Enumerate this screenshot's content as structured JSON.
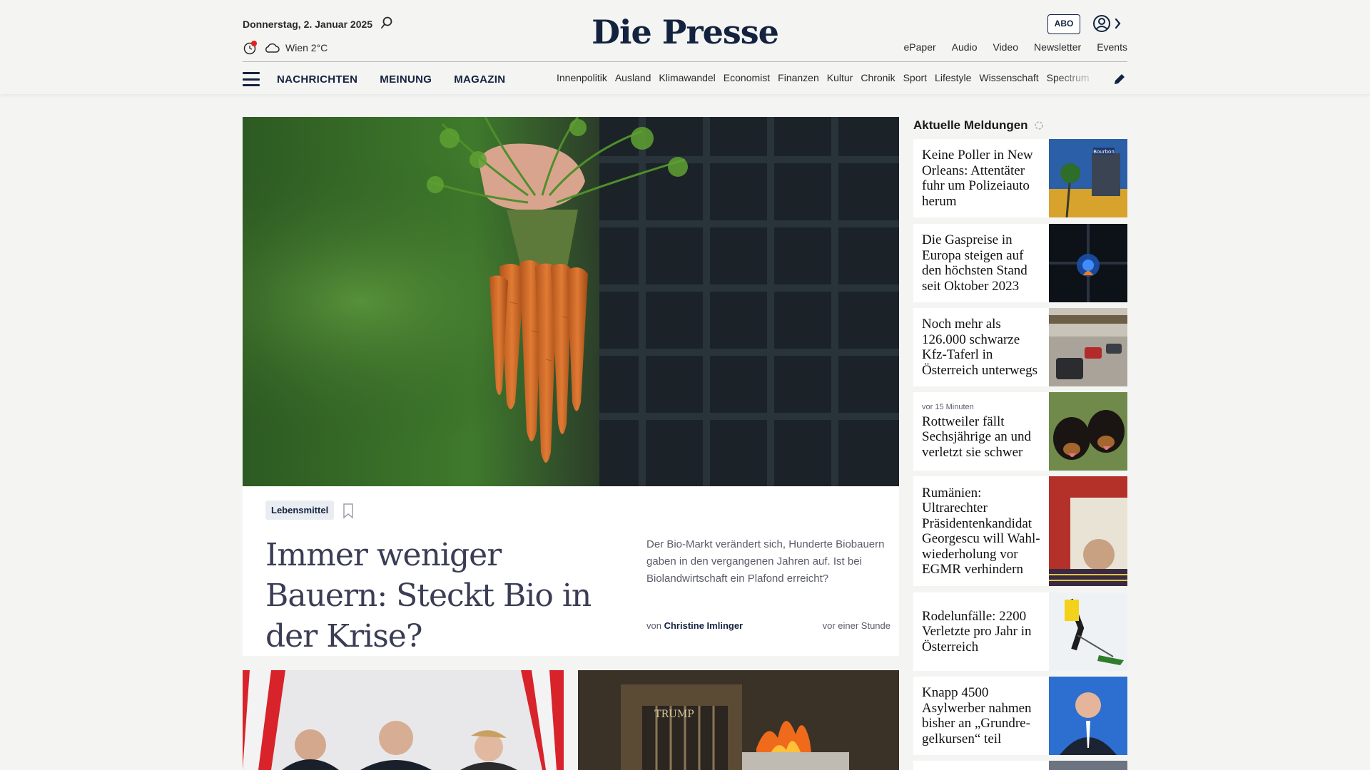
{
  "header": {
    "date": "Donnerstag, 2. Januar 2025",
    "weather": "Wien 2°C",
    "logo": "Die Presse",
    "abo_label": "ABO",
    "top_links": [
      "ePaper",
      "Audio",
      "Video",
      "Newsletter",
      "Events"
    ]
  },
  "nav": {
    "main": [
      "NACHRICHTEN",
      "MEINUNG",
      "MAGAZIN"
    ],
    "sections": [
      "Innenpolitik",
      "Ausland",
      "Klimawandel",
      "Economist",
      "Finanzen",
      "Kultur",
      "Chronik",
      "Sport",
      "Lifestyle",
      "Wissenschaft",
      "Spectrum"
    ]
  },
  "hero": {
    "tag": "Lebensmittel",
    "title": "Immer weniger Bauern: Steckt Bio in der Krise?",
    "lead": "Der Bio-Markt verändert sich, Hunderte Biobauern gaben in den vergangenen Jahren auf. Ist bei Biolandwirtschaft ein Plafond erreicht?",
    "author_prefix": "von",
    "author": "Christine Imlinger",
    "time": "vor einer Stunde"
  },
  "sidebar": {
    "title": "Aktuelle Meldungen",
    "items": [
      {
        "time": "",
        "title": "Keine Poller in New Orleans: Attentäter fuhr um Polizeiauto herum"
      },
      {
        "time": "",
        "title": "Die Gaspreise in Europa steigen auf den höchsten Stand seit Oktober 2023"
      },
      {
        "time": "",
        "title": "Noch mehr als 126.000 schwarze Kfz-Taferl in Österreich unterwegs"
      },
      {
        "time": "vor 15 Minuten",
        "title": "Rottweiler fällt Sechsjährige an und verletzt sie schwer"
      },
      {
        "time": "",
        "title": "Rumänien: Ultrarechter Präsidentenkandidat Georgescu will Wahl-wiederholung vor EGMR verhindern"
      },
      {
        "time": "",
        "title": "Rodelunfälle: 2200 Verletzte pro Jahr in Österreich"
      },
      {
        "time": "",
        "title": "Knapp 4500 Asylwerber nahmen bisher an „Grundre-gelkursen“ teil"
      }
    ]
  },
  "image_text": {
    "bourbon_sign": "Bourbon",
    "trump_sign": "TRUMP"
  },
  "colors": {
    "brand_navy": "#13233f",
    "page_bg": "#f4f4f3",
    "weather_alert": "#e2231a"
  }
}
